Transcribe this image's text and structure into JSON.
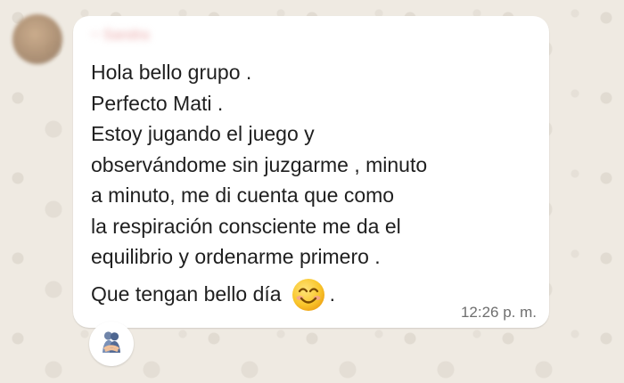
{
  "message": {
    "sender": "~ Sandra",
    "lines": [
      "Hola bello grupo .",
      "Perfecto Mati .",
      "Estoy jugando el juego y",
      "observándome sin juzgarme , minuto",
      "a minuto, me di cuenta que como",
      "la respiración consciente me da el",
      "equilibrio y ordenarme primero ."
    ],
    "last_line_text": "Que tengan bello día",
    "last_line_suffix": ".",
    "emoji": "smiling-face-with-smiling-eyes",
    "time": "12:26 p. m."
  },
  "reaction": {
    "icon": "people-hugging"
  },
  "colors": {
    "background": "#efeae2",
    "bubble": "#ffffff",
    "text": "#1f1f1f",
    "time": "#6f6f6f",
    "sender": "#e8a3a3"
  }
}
